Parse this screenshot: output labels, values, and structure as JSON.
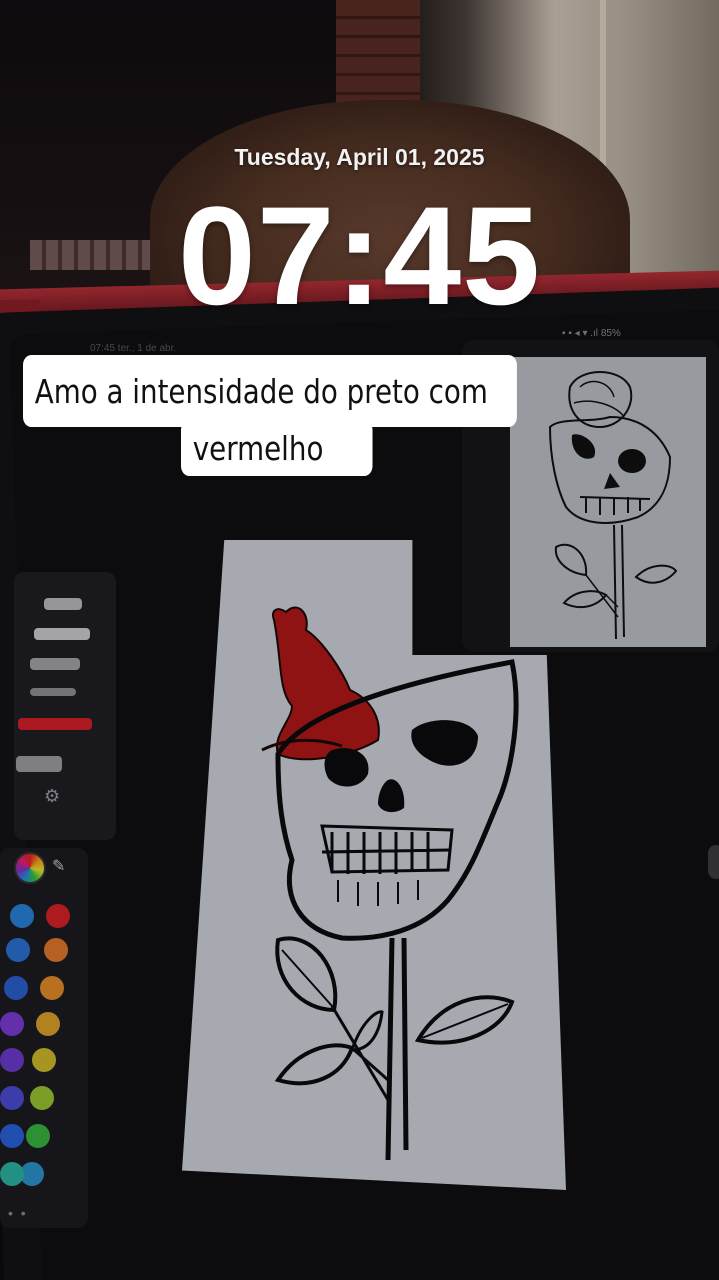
{
  "lock_screen": {
    "date": "Tuesday, April 01, 2025",
    "time": "07:45"
  },
  "caption": {
    "line1": "Amo a intensidade do preto com",
    "line2": "vermelho"
  },
  "tablet_status": {
    "left": "07:45  ter., 1 de abr.",
    "battery": "85%"
  },
  "tools": [
    {
      "name": "pencil-tool",
      "color": "#b8b8bc"
    },
    {
      "name": "brush-tool",
      "color": "#c8c8cc"
    },
    {
      "name": "marker-tool",
      "color": "#a0a0a6"
    },
    {
      "name": "pen-tool",
      "color": "#8c8c92"
    },
    {
      "name": "red-pen-tool",
      "color": "#d02028"
    },
    {
      "name": "eraser-tool",
      "color": "#9a9aa0"
    }
  ],
  "palette": {
    "colors": [
      "#2a7fd6",
      "#d42026",
      "#2a6fd0",
      "#e0762a",
      "#2a5fc8",
      "#e08a28",
      "#7a3ad0",
      "#d8a028",
      "#6a3ac8",
      "#c8b828",
      "#4a4ad0",
      "#98c030",
      "#2a60d8",
      "#38b040",
      "#2a90c8",
      "#2ab0a0"
    ]
  },
  "icons": {
    "settings": "gear-icon",
    "eyedropper": "eyedropper-icon",
    "color_wheel": "color-wheel-icon"
  }
}
